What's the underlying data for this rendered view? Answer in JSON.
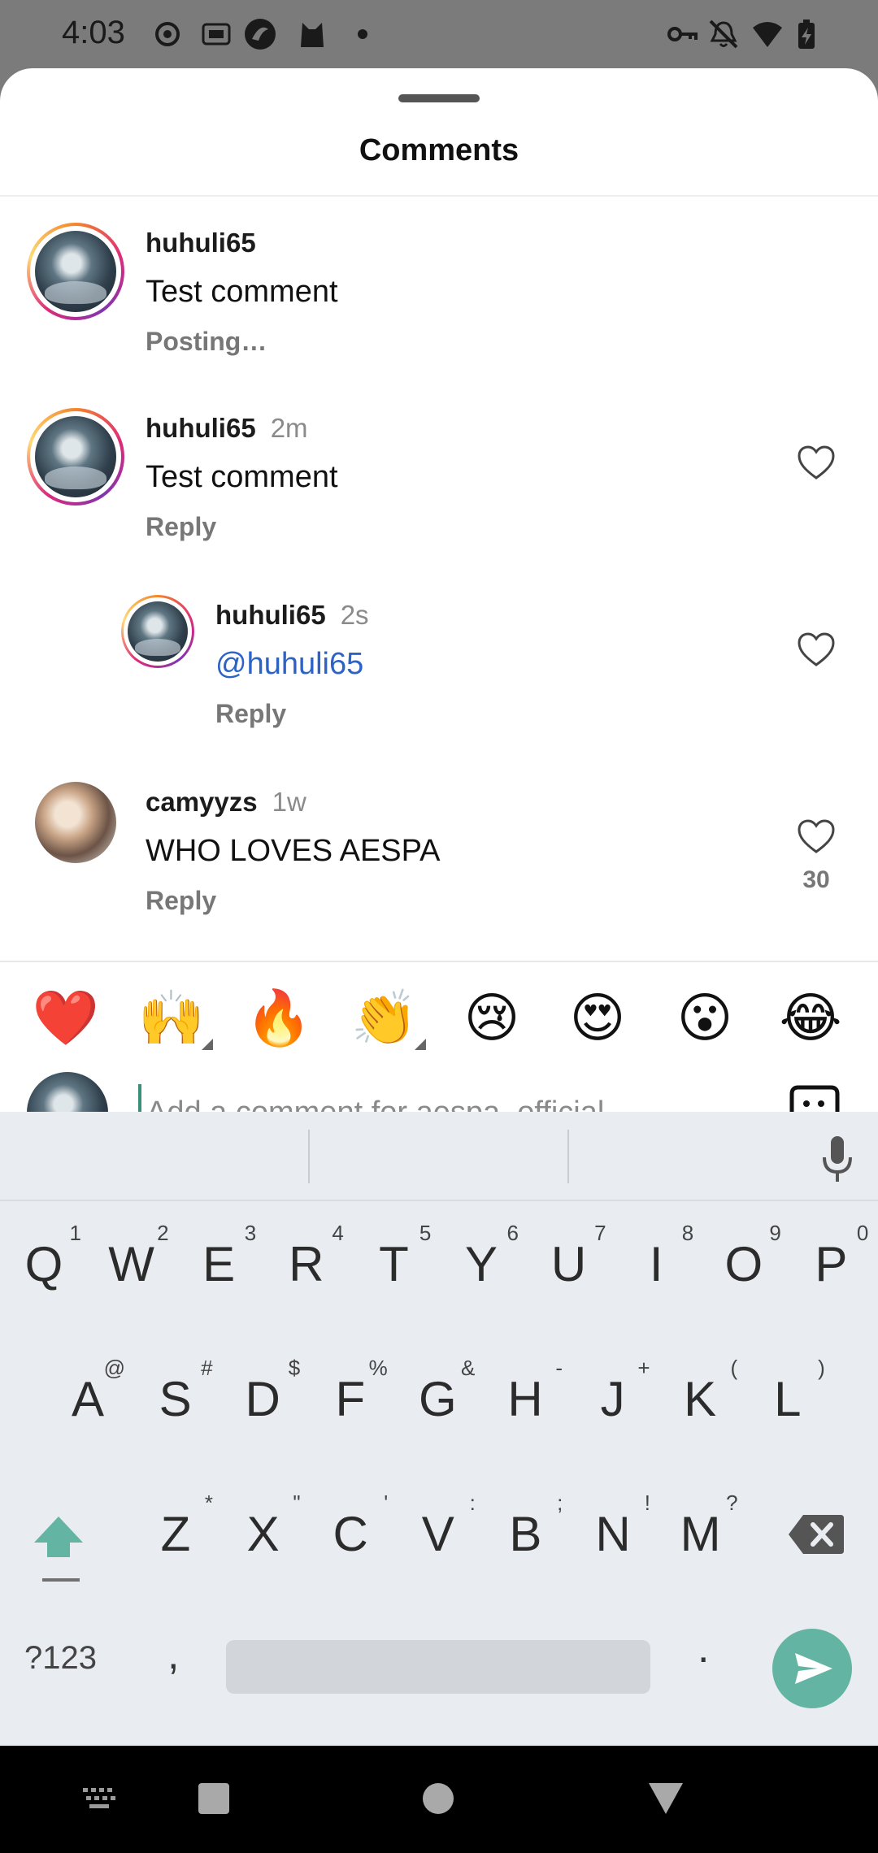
{
  "status_bar": {
    "time": "4:03"
  },
  "sheet": {
    "title": "Comments"
  },
  "comments": [
    {
      "user": "huhuli65",
      "time": "",
      "text": "Test comment",
      "meta": "Posting…"
    },
    {
      "user": "huhuli65",
      "time": "2m",
      "text": "Test comment",
      "meta": "Reply"
    },
    {
      "user": "huhuli65",
      "time": "2s",
      "text": "@huhuli65",
      "meta": "Reply"
    },
    {
      "user": "camyyzs",
      "time": "1w",
      "text": "WHO LOVES AESPA",
      "meta": "Reply",
      "likes": "30"
    }
  ],
  "reactions": [
    "❤️",
    "🙌",
    "🔥",
    "👏",
    "😢",
    "😍",
    "😮",
    "😂"
  ],
  "input": {
    "placeholder": "Add a comment for aespa_official…"
  },
  "keyboard": {
    "row1": [
      {
        "k": "Q",
        "h": "1"
      },
      {
        "k": "W",
        "h": "2"
      },
      {
        "k": "E",
        "h": "3"
      },
      {
        "k": "R",
        "h": "4"
      },
      {
        "k": "T",
        "h": "5"
      },
      {
        "k": "Y",
        "h": "6"
      },
      {
        "k": "U",
        "h": "7"
      },
      {
        "k": "I",
        "h": "8"
      },
      {
        "k": "O",
        "h": "9"
      },
      {
        "k": "P",
        "h": "0"
      }
    ],
    "row2": [
      {
        "k": "A",
        "h": "@"
      },
      {
        "k": "S",
        "h": "#"
      },
      {
        "k": "D",
        "h": "$"
      },
      {
        "k": "F",
        "h": "%"
      },
      {
        "k": "G",
        "h": "&"
      },
      {
        "k": "H",
        "h": "-"
      },
      {
        "k": "J",
        "h": "+"
      },
      {
        "k": "K",
        "h": "("
      },
      {
        "k": "L",
        "h": ")"
      }
    ],
    "row3": [
      {
        "k": "Z",
        "h": "*"
      },
      {
        "k": "X",
        "h": "\""
      },
      {
        "k": "C",
        "h": "'"
      },
      {
        "k": "V",
        "h": ":"
      },
      {
        "k": "B",
        "h": ";"
      },
      {
        "k": "N",
        "h": "!"
      },
      {
        "k": "M",
        "h": "?"
      }
    ],
    "symbols_label": "?123",
    "comma": ",",
    "period": "."
  },
  "colors": {
    "accent": "#63b4a2",
    "mention": "#2e63c6",
    "sheet_bg": "#ffffff",
    "keyboard_bg": "#e9edf1"
  }
}
